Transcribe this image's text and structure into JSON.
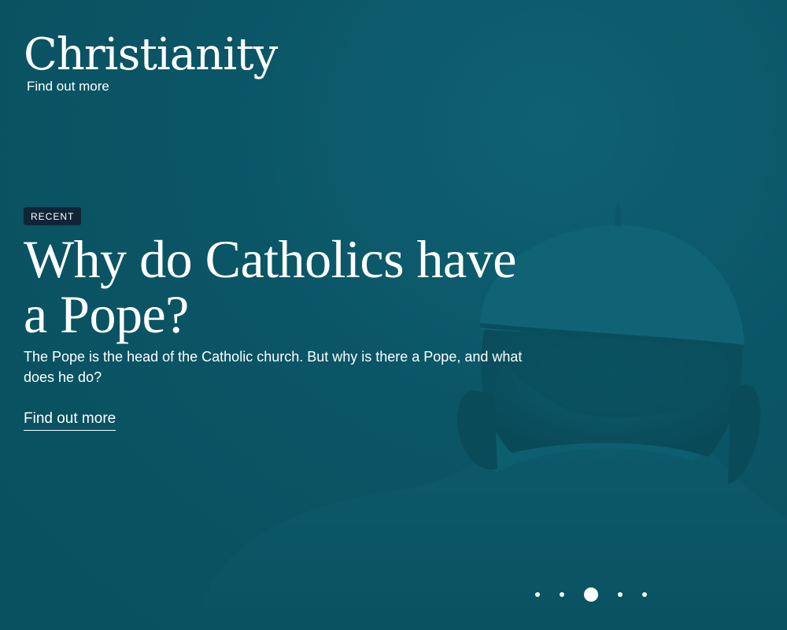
{
  "brand": {
    "title": "Christianity",
    "link_label": "Find out more"
  },
  "hero": {
    "badge": "RECENT",
    "headline": "Why do Catholics have a Pope?",
    "summary": "The Pope is the head of the Catholic church. But why is there a Pope, and what does he do?",
    "cta_label": "Find out more",
    "image_subject": "Pope seen from behind wearing a zucchetto",
    "tint_color": "#0b5568"
  },
  "carousel": {
    "slide_count": 5,
    "active_index": 2
  },
  "colors": {
    "background": "#0b5568",
    "badge_background": "#112436",
    "text": "#ffffff"
  }
}
